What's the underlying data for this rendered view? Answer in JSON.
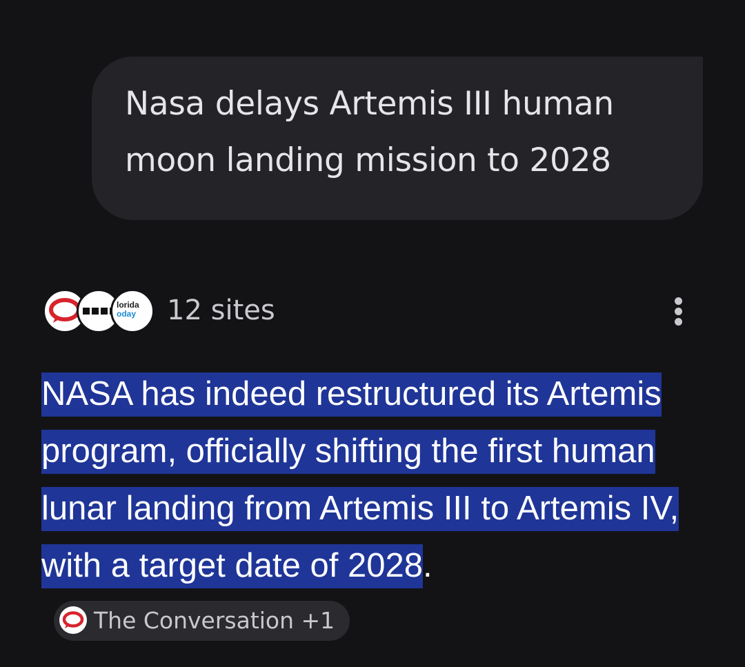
{
  "query": {
    "text": "Nasa delays Artemis III human moon landing mission to 2028"
  },
  "sources": {
    "count_label": "12 sites",
    "favicons": [
      {
        "icon": "the-conversation-icon"
      },
      {
        "icon": "dotted-logo-icon"
      },
      {
        "icon": "florida-today-icon",
        "line1": "lorida",
        "line2": "oday"
      }
    ]
  },
  "answer": {
    "highlighted_text": "NASA has indeed restructured its Artemis program, officially shifting the first human lunar landing from Artemis III to Artemis IV, with a target date of 2028",
    "trailing": ".",
    "citation": {
      "label": "The Conversation +1",
      "icon": "the-conversation-icon"
    }
  },
  "colors": {
    "background": "#131316",
    "bubble": "#232328",
    "highlight": "#1f3597",
    "conversation_red": "#d7242c"
  }
}
